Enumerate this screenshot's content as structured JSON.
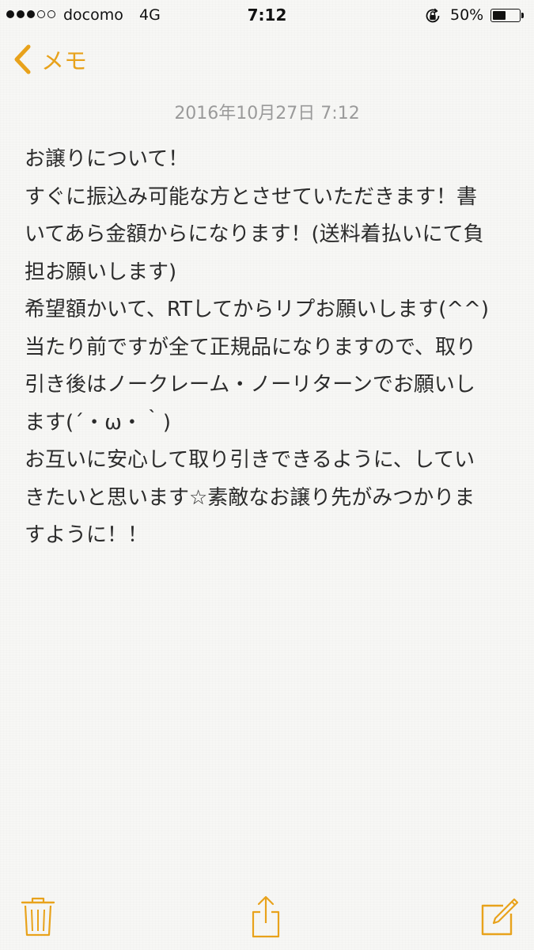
{
  "status_bar": {
    "carrier": "docomo",
    "network": "4G",
    "time": "7:12",
    "battery_percent_label": "50%",
    "battery_level": 0.5,
    "signal_bars_filled": 3,
    "signal_bars_total": 5
  },
  "nav": {
    "back_label": "メモ"
  },
  "note": {
    "date": "2016年10月27日 7:12",
    "lines": [
      "お譲りについて！",
      "すぐに振込み可能な方とさせていただきます！書",
      "いてあら金額からになります！(送料着払いにて負",
      "担お願いします)",
      "希望額かいて、RTしてからリプお願いします(^^)",
      "当たり前ですが全て正規品になりますので、取り",
      "引き後はノークレーム・ノーリターンでお願いし",
      "ます(´・ω・｀)",
      "お互いに安心して取り引きできるように、してい",
      "きたいと思います☆素敵なお譲り先がみつかりま",
      "すように！！"
    ]
  },
  "colors": {
    "accent": "#e8a21b",
    "date_text": "#9a9a9a",
    "body_text": "#2b2b2b"
  },
  "toolbar": {
    "icons": [
      "trash-icon",
      "share-icon",
      "compose-icon"
    ]
  }
}
